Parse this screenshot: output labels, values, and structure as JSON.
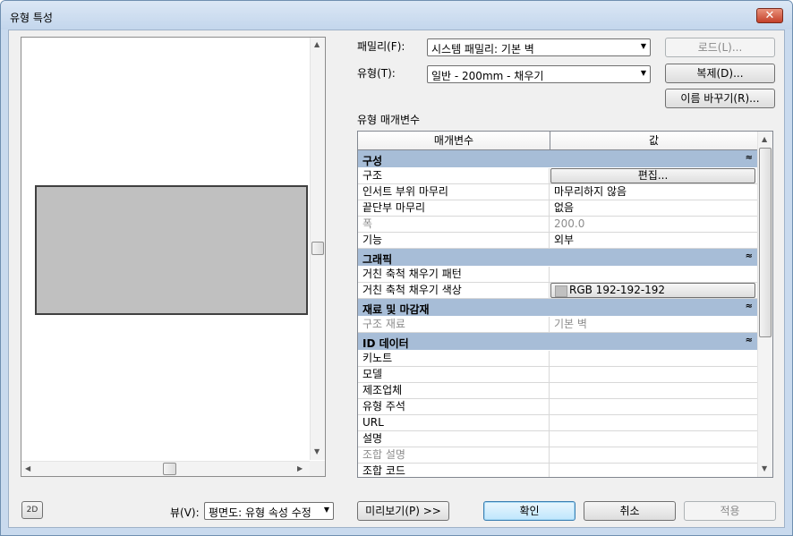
{
  "window": {
    "title": "유형 특성",
    "close_glyph": "✕"
  },
  "family": {
    "label": "패밀리(F):",
    "value": "시스템 패밀리: 기본 벽"
  },
  "type": {
    "label": "유형(T):",
    "value": "일반 - 200mm - 채우기"
  },
  "buttons": {
    "load": "로드(L)...",
    "duplicate": "복제(D)...",
    "rename": "이름 바꾸기(R)...",
    "preview": "미리보기(P) >>",
    "ok": "확인",
    "cancel": "취소",
    "apply": "적용"
  },
  "type_params_label": "유형 매개변수",
  "grid": {
    "header_param": "매개변수",
    "header_value": "값",
    "groups": {
      "construction": "구성",
      "graphics": "그래픽",
      "materials": "재료 및 마감재",
      "identity": "ID 데이터"
    },
    "collapse_glyph": "≈",
    "rows": {
      "structure": {
        "name": "구조",
        "value": "편집..."
      },
      "wrap_inserts": {
        "name": "인서트 부위 마무리",
        "value": "마무리하지 않음"
      },
      "wrap_ends": {
        "name": "끝단부 마무리",
        "value": "없음"
      },
      "width": {
        "name": "폭",
        "value": "200.0"
      },
      "function": {
        "name": "기능",
        "value": "외부"
      },
      "coarse_pattern": {
        "name": "거친 축척 채우기 패턴",
        "value": ""
      },
      "coarse_color": {
        "name": "거친 축척 채우기 색상",
        "value": "RGB 192-192-192"
      },
      "structural_material": {
        "name": "구조 재료",
        "value": "기본 벽"
      },
      "keynote": {
        "name": "키노트",
        "value": ""
      },
      "model": {
        "name": "모델",
        "value": ""
      },
      "manufacturer": {
        "name": "제조업체",
        "value": ""
      },
      "type_comments": {
        "name": "유형 주석",
        "value": ""
      },
      "url": {
        "name": "URL",
        "value": ""
      },
      "description": {
        "name": "설명",
        "value": ""
      },
      "assembly_desc": {
        "name": "조합 설명",
        "value": ""
      },
      "assembly_code": {
        "name": "조합 코드",
        "value": ""
      }
    }
  },
  "view": {
    "label": "뷰(V):",
    "value": "평면도: 유형 속성 수정"
  },
  "icons": {
    "view_2d": "2D"
  },
  "colors": {
    "group_header": "#a7bdd7",
    "swatch": "#c0c0c0",
    "wall_fill": "#c0c0c0"
  }
}
